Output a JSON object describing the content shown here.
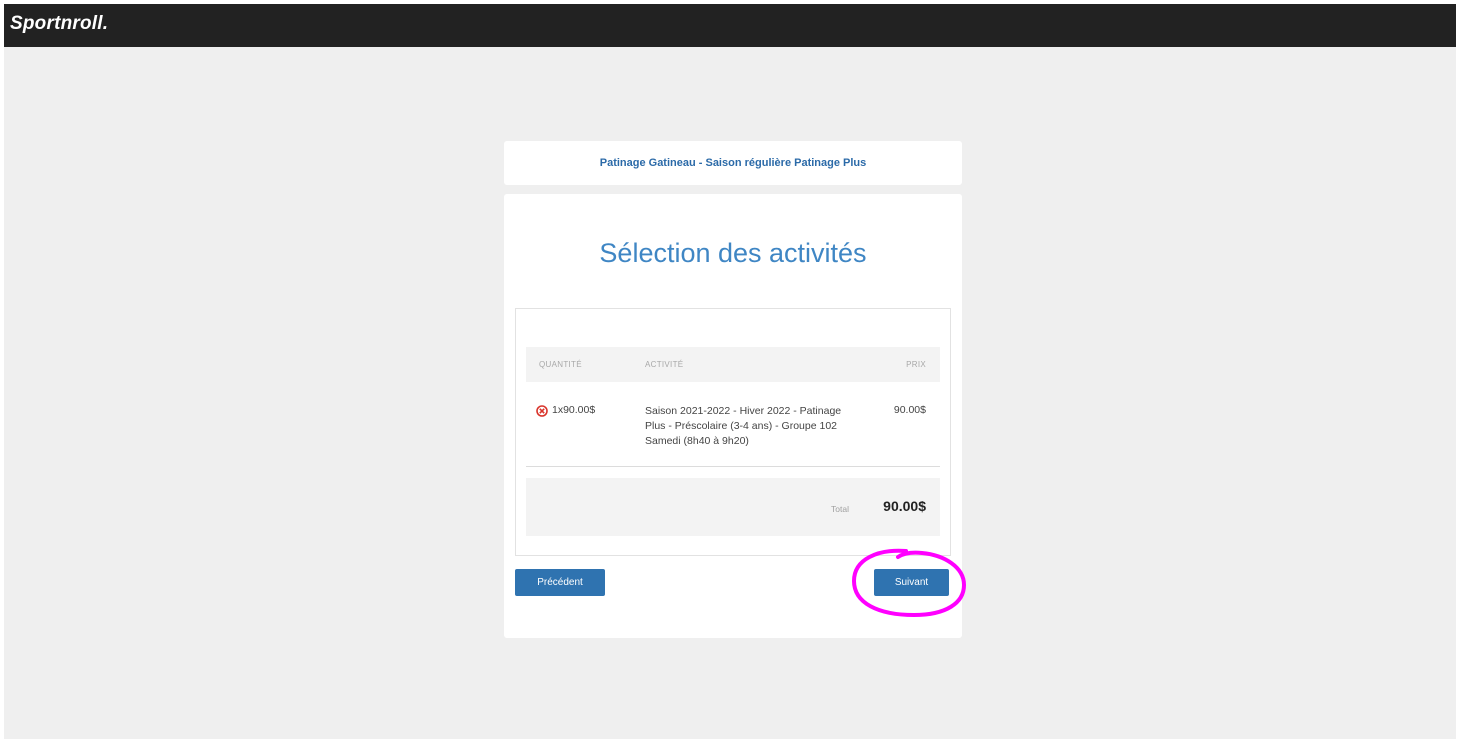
{
  "header": {
    "logo": "Sportnroll."
  },
  "org": {
    "title": "Patinage Gatineau - Saison régulière Patinage Plus"
  },
  "page": {
    "title": "Sélection des activités"
  },
  "cart": {
    "columns": {
      "quantity": "QUANTITÉ",
      "activity": "ACTIVITÉ",
      "price": "PRIX"
    },
    "items": [
      {
        "quantity": "1x90.00$",
        "activity": "Saison 2021-2022 - Hiver 2022 - Patinage Plus - Préscolaire (3-4 ans) - Groupe 102 Samedi (8h40 à 9h20)",
        "price": "90.00$",
        "remove_icon": "remove-circle-icon"
      }
    ],
    "total_label": "Total",
    "total_value": "90.00$"
  },
  "buttons": {
    "previous": "Précédent",
    "next": "Suivant"
  },
  "colors": {
    "topbar": "#222222",
    "background": "#efefef",
    "primary_button": "#2f73b0",
    "title_blue": "#3f86c4",
    "remove_red": "#d9342b",
    "annotation_magenta": "#ff00ff"
  }
}
